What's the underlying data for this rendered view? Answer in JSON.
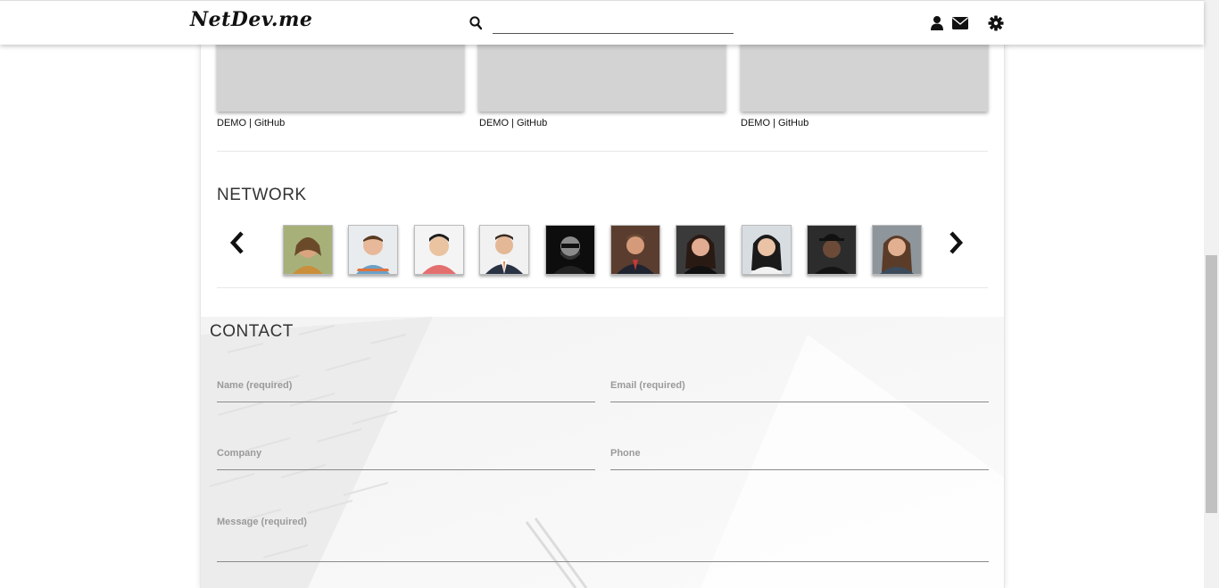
{
  "header": {
    "logo": "NetDev.me",
    "search_placeholder": ""
  },
  "projects": [
    {
      "demo": "DEMO",
      "sep": "|",
      "github": "GitHub"
    },
    {
      "demo": "DEMO",
      "sep": "|",
      "github": "GitHub"
    },
    {
      "demo": "DEMO",
      "sep": "|",
      "github": "GitHub"
    }
  ],
  "network": {
    "title": "NETWORK",
    "avatar_count": 10
  },
  "contact": {
    "title": "CONTACT",
    "fields": {
      "name": "Name (required)",
      "email": "Email (required)",
      "company": "Company",
      "phone": "Phone",
      "message": "Message (required)"
    }
  },
  "colors": {
    "placeholder_gray": "#d3d3d3",
    "label_gray": "#9a9a9a"
  }
}
